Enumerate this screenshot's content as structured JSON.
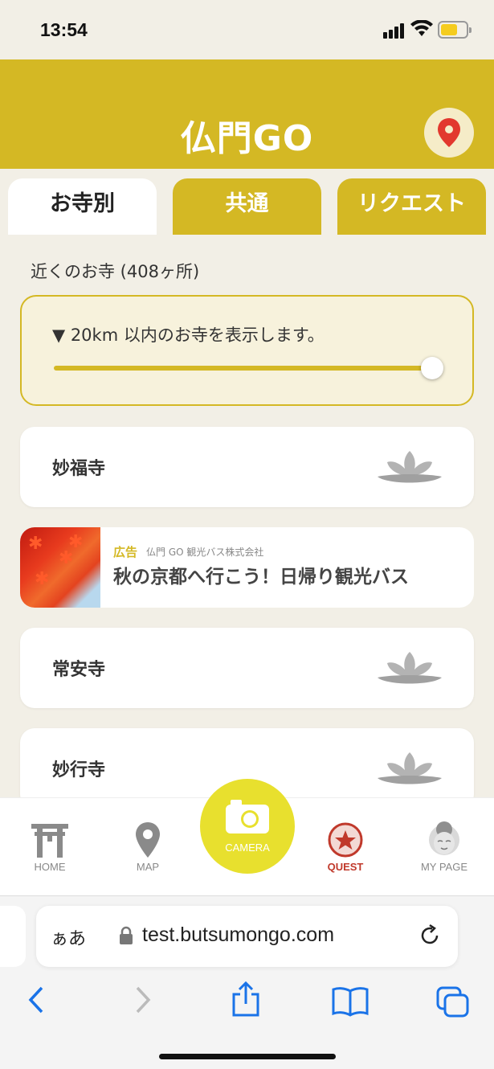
{
  "status_bar": {
    "time": "13:54"
  },
  "header": {
    "logo": "仏門GO",
    "map_button_icon": "map-pin-icon"
  },
  "tabs": [
    {
      "label": "お寺別",
      "active": true
    },
    {
      "label": "共通",
      "active": false
    },
    {
      "label": "リクエスト",
      "active": false
    }
  ],
  "nearby": {
    "label": "近くのお寺 (408ヶ所)",
    "range_text": "▼ 20km 以内のお寺を表示します。",
    "range_slider_value": 1.0
  },
  "temples": [
    {
      "name": "妙福寺",
      "icon": "lotus-icon"
    },
    {
      "name": "常安寺",
      "icon": "lotus-icon"
    },
    {
      "name": "妙行寺",
      "icon": "lotus-icon"
    }
  ],
  "ad": {
    "tag": "広告",
    "sponsor": "仏門 GO 観光バス株式会社",
    "title": "秋の京都へ行こう！日帰り観光バス"
  },
  "bottom_nav": {
    "home": "HOME",
    "map": "MAP",
    "camera": "CAMERA",
    "quest": "QUEST",
    "mypage": "MY PAGE"
  },
  "browser": {
    "text_size": "ぁあ",
    "url": "test.butsumongo.com"
  },
  "colors": {
    "brand": "#d4b824",
    "camera": "#e8e02e",
    "quest": "#c0392b",
    "ios_blue": "#1a73e8"
  }
}
